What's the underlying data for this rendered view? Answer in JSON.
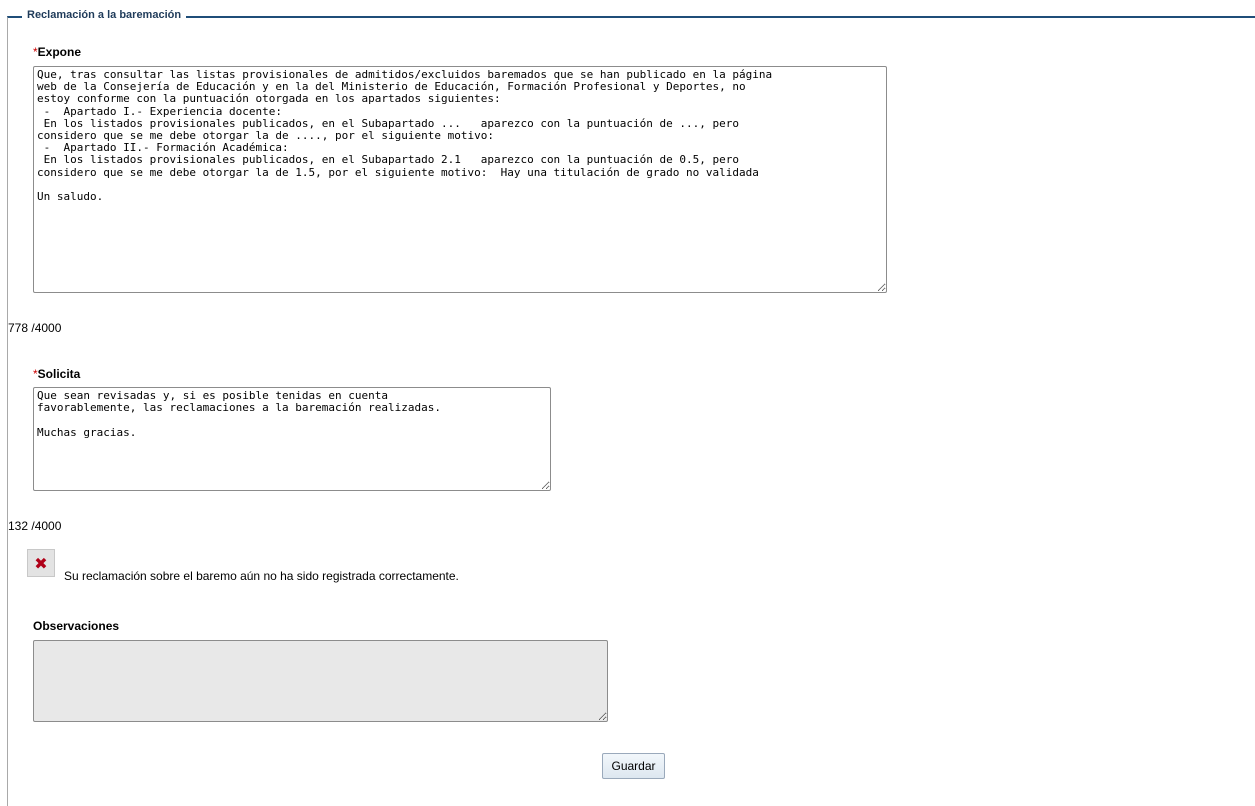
{
  "fieldset": {
    "legend": "Reclamación a la baremación"
  },
  "expone": {
    "required_mark": "*",
    "label": "Expone",
    "value": "Que, tras consultar las listas provisionales de admitidos/excluidos baremados que se han publicado en la página\nweb de la Consejería de Educación y en la del Ministerio de Educación, Formación Profesional y Deportes, no\nestoy conforme con la puntuación otorgada en los apartados siguientes:\n -  Apartado I.- Experiencia docente:\n En los listados provisionales publicados, en el Subapartado ...   aparezco con la puntuación de ..., pero\nconsidero que se me debe otorgar la de ...., por el siguiente motivo:\n -  Apartado II.- Formación Académica:\n En los listados provisionales publicados, en el Subapartado 2.1   aparezco con la puntuación de 0.5, pero\nconsidero que se me debe otorgar la de 1.5, por el siguiente motivo:  Hay una titulación de grado no validada\n\nUn saludo.",
    "counter": "778 /4000"
  },
  "solicita": {
    "required_mark": "*",
    "label": "Solicita",
    "value": "Que sean revisadas y, si es posible tenidas en cuenta\nfavorablemente, las reclamaciones a la baremación realizadas.\n\nMuchas gracias.",
    "counter": "132 /4000"
  },
  "status": {
    "icon": "error-x-icon",
    "icon_glyph": "✖",
    "color": "#b00018",
    "message": "Su reclamación sobre el baremo aún no ha sido registrada correctamente."
  },
  "observaciones": {
    "label": "Observaciones",
    "value": ""
  },
  "actions": {
    "save_label": "Guardar"
  }
}
